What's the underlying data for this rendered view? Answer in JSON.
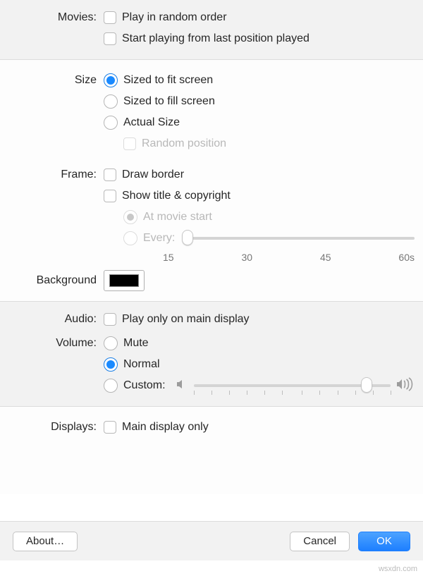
{
  "movies": {
    "label": "Movies:",
    "random": "Play in random order",
    "resume": "Start playing from last position played"
  },
  "size": {
    "label": "Size",
    "fit": "Sized to fit screen",
    "fill": "Sized to fill screen",
    "actual": "Actual Size",
    "randompos": "Random position"
  },
  "frame": {
    "label": "Frame:",
    "border": "Draw border",
    "title": "Show title & copyright",
    "atstart": "At movie start",
    "every": "Every:",
    "ticks": {
      "t0": "15",
      "t1": "30",
      "t2": "45",
      "t3": "60s"
    }
  },
  "background": {
    "label": "Background",
    "color": "#000000"
  },
  "audio": {
    "label": "Audio:",
    "mainonly": "Play only on main display"
  },
  "volume": {
    "label": "Volume:",
    "mute": "Mute",
    "normal": "Normal",
    "custom": "Custom:"
  },
  "displays": {
    "label": "Displays:",
    "mainonly": "Main display only"
  },
  "buttons": {
    "about": "About…",
    "cancel": "Cancel",
    "ok": "OK"
  },
  "watermark": "wsxdn.com"
}
